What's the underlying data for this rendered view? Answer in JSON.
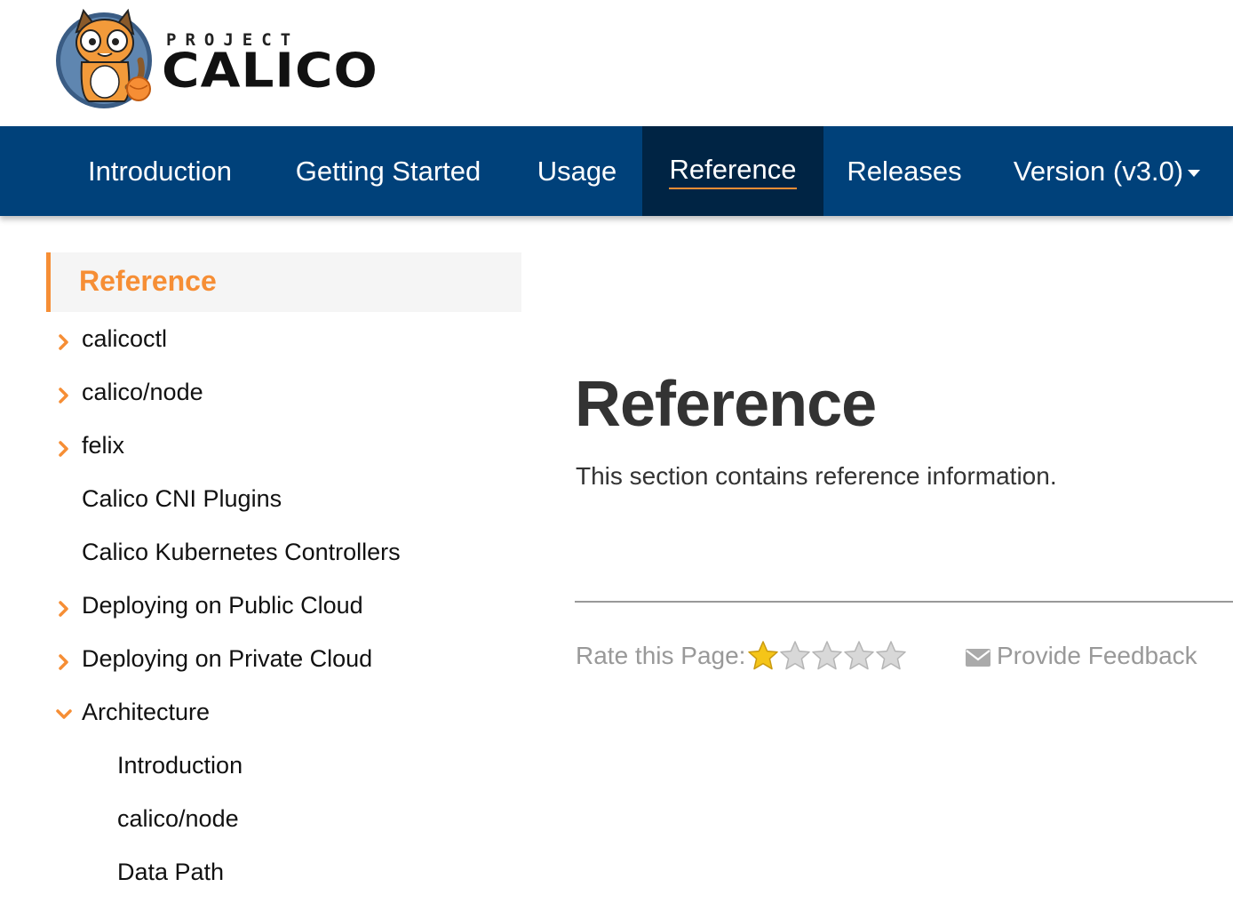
{
  "logo": {
    "project_text": "PROJECT",
    "calico_text": "CALICO"
  },
  "nav": {
    "items": [
      {
        "label": "Introduction"
      },
      {
        "label": "Getting Started"
      },
      {
        "label": "Usage"
      },
      {
        "label": "Reference",
        "active": true
      },
      {
        "label": "Releases"
      },
      {
        "label": "Version (v3.0)",
        "dropdown": true
      }
    ]
  },
  "sidebar": {
    "header": "Reference",
    "items": [
      {
        "label": "calicoctl",
        "icon": "chevron-right-icon"
      },
      {
        "label": "calico/node",
        "icon": "chevron-right-icon"
      },
      {
        "label": "felix",
        "icon": "chevron-right-icon"
      },
      {
        "label": "Calico CNI Plugins"
      },
      {
        "label": "Calico Kubernetes Controllers"
      },
      {
        "label": "Deploying on Public Cloud",
        "icon": "chevron-right-icon"
      },
      {
        "label": "Deploying on Private Cloud",
        "icon": "chevron-right-icon"
      },
      {
        "label": "Architecture",
        "icon": "chevron-down-icon",
        "expanded": true
      },
      {
        "label": "Introduction",
        "level": 2
      },
      {
        "label": "calico/node",
        "level": 2
      },
      {
        "label": "Data Path",
        "level": 2
      }
    ]
  },
  "main": {
    "title": "Reference",
    "description": "This section contains reference information."
  },
  "rating": {
    "label": "Rate this Page:",
    "stars_total": 5,
    "stars_filled": 1
  },
  "feedback": {
    "label": "Provide Feedback",
    "icon": "envelope-icon"
  },
  "colors": {
    "navbar": "#00417a",
    "navbar_active": "#002444",
    "accent": "#f68e35",
    "muted_text": "#999999",
    "star_filled": "#f5c518",
    "star_empty": "#d8d8d8"
  }
}
